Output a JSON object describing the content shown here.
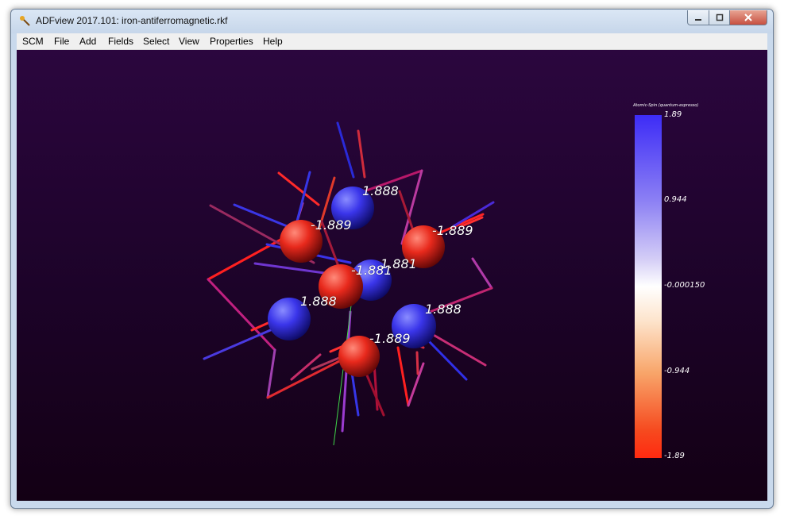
{
  "window": {
    "title": "ADFview 2017.101: iron-antiferromagnetic.rkf"
  },
  "menu": {
    "items": [
      "SCM",
      "File",
      "Add",
      "Fields",
      "Select",
      "View",
      "Properties",
      "Help"
    ]
  },
  "scene": {
    "atoms": [
      {
        "spin": "blue",
        "label": "1.888"
      },
      {
        "spin": "red",
        "label": "-1.889"
      },
      {
        "spin": "red",
        "label": "-1.889"
      },
      {
        "spin": "blue",
        "label": "1.881"
      },
      {
        "spin": "red",
        "label": "-1.881"
      },
      {
        "spin": "blue",
        "label": "1.888"
      },
      {
        "spin": "blue",
        "label": "1.888"
      },
      {
        "spin": "red",
        "label": "-1.889"
      }
    ],
    "colors": {
      "positive": "#3a2cf0",
      "negative": "#ff2a14",
      "bond_mid": "#9a3fbf"
    }
  },
  "colorbar": {
    "title": "Atomic-Spin (quantum-espresso)",
    "max_label": "1.89",
    "upper_label": "0.944",
    "mid_label": "-0.000150",
    "lower_label": "-0.944",
    "min_label": "-1.89"
  }
}
